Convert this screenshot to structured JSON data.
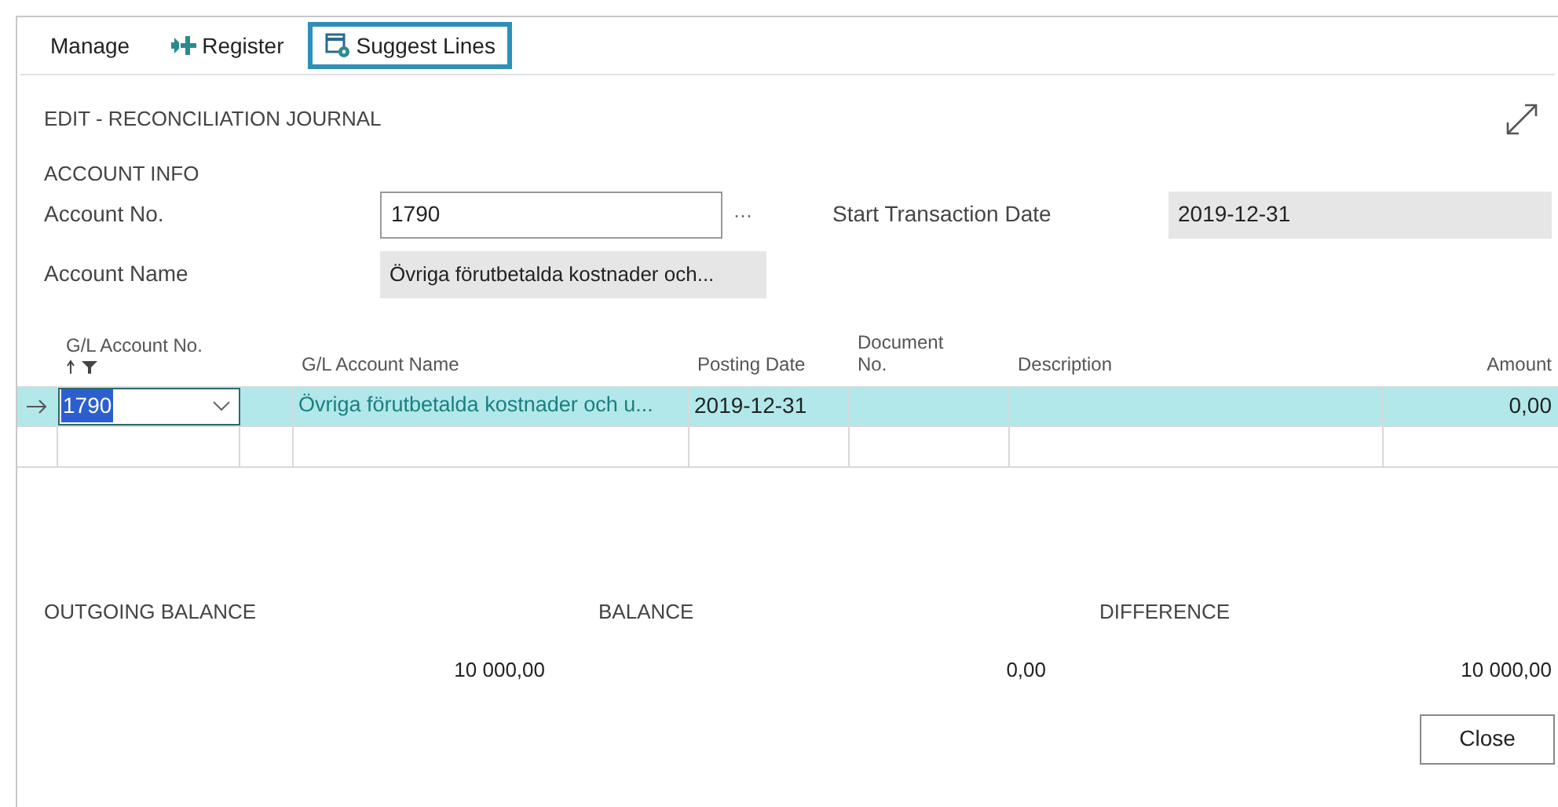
{
  "toolbar": [
    {
      "kind": "menu",
      "label": "Manage",
      "selected": false
    },
    {
      "kind": "register",
      "label": "Register",
      "selected": false
    },
    {
      "kind": "suggest",
      "label": "Suggest Lines",
      "selected": true
    }
  ],
  "title": "EDIT - RECONCILIATION JOURNAL",
  "account_info": {
    "heading": "ACCOUNT INFO",
    "account_no_label": "Account No.",
    "account_no": "1790",
    "lookup": "···",
    "start_date_label": "Start Transaction Date",
    "start_date": "2019-12-31",
    "account_name_label": "Account Name",
    "account_name": "Övriga förutbetalda kostnader och..."
  },
  "table": {
    "columns": [
      "G/L Account No.",
      "G/L Account Name",
      "Posting Date",
      "Document No.",
      "Description",
      "Amount"
    ],
    "rows": [
      {
        "selected": true,
        "gl_account_no": "1790",
        "gl_account_name": "Övriga förutbetalda kostnader och u...",
        "posting_date": "2019-12-31",
        "amount": "0,00"
      }
    ]
  },
  "balances": [
    {
      "label": "OUTGOING BALANCE",
      "value": "10 000,00"
    },
    {
      "label": "BALANCE",
      "value": "0,00"
    },
    {
      "label": "DIFFERENCE",
      "value": "10 000,00"
    }
  ],
  "buttons": [
    "Close"
  ]
}
